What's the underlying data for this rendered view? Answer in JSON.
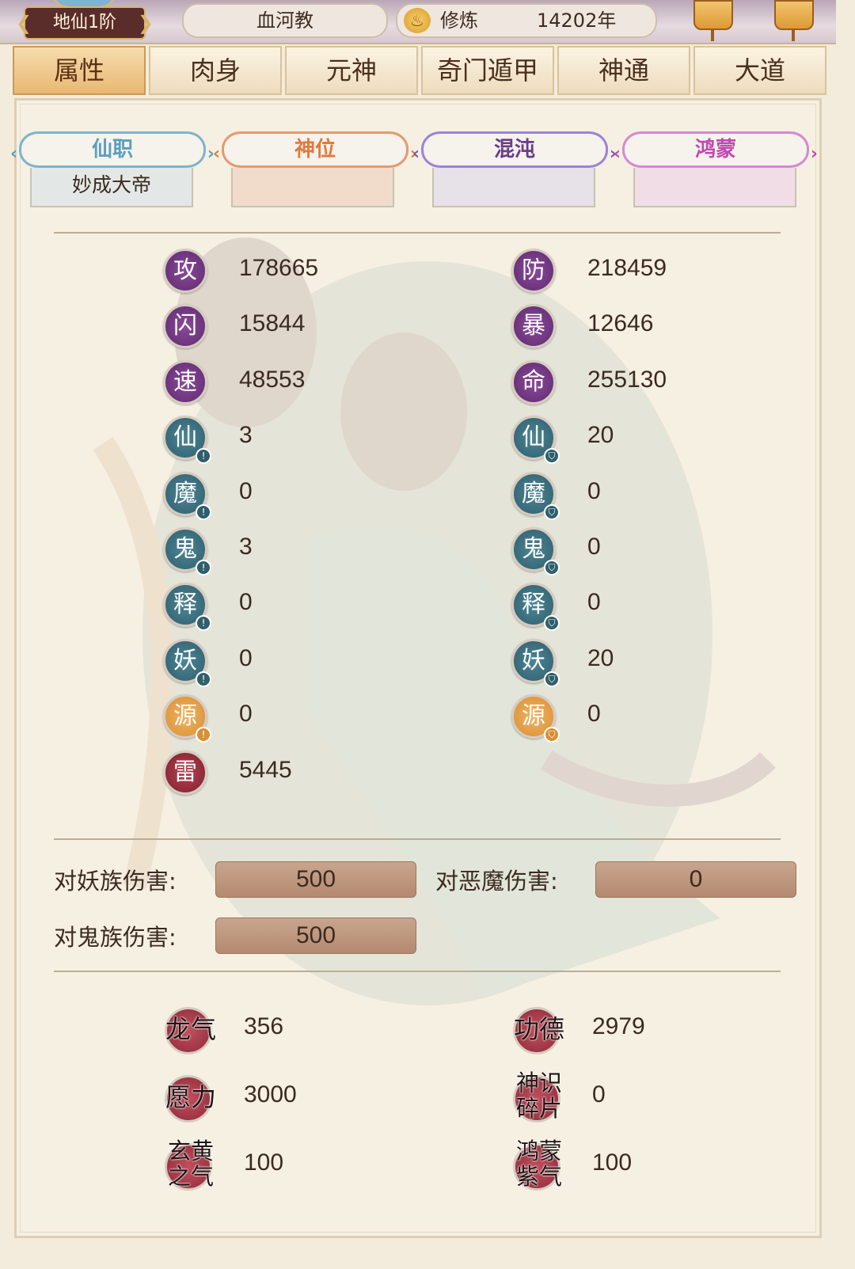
{
  "topbar": {
    "rank": "地仙1阶",
    "sect": "血河教",
    "cultivation_label": "修炼",
    "cultivation_value": "14202年",
    "cultivation_icon": "meditation-icon"
  },
  "tabs": [
    "属性",
    "肉身",
    "元神",
    "奇门遁甲",
    "神通",
    "大道"
  ],
  "active_tab": "属性",
  "titles": [
    {
      "label": "仙职",
      "value": "妙成大帝",
      "color": "#5aa0bd"
    },
    {
      "label": "神位",
      "value": "",
      "color": "#e07a3c"
    },
    {
      "label": "混沌",
      "value": "",
      "color": "#6a3e8a"
    },
    {
      "label": "鸿蒙",
      "value": "",
      "color": "#c04ab0"
    }
  ],
  "stats_left": [
    {
      "char": "攻",
      "value": "178665",
      "kind": "purple"
    },
    {
      "char": "闪",
      "value": "15844",
      "kind": "purple"
    },
    {
      "char": "速",
      "value": "48553",
      "kind": "purple"
    },
    {
      "char": "仙",
      "value": "3",
      "kind": "teal",
      "mark": "!"
    },
    {
      "char": "魔",
      "value": "0",
      "kind": "teal",
      "mark": "!"
    },
    {
      "char": "鬼",
      "value": "3",
      "kind": "teal",
      "mark": "!"
    },
    {
      "char": "释",
      "value": "0",
      "kind": "teal",
      "mark": "!"
    },
    {
      "char": "妖",
      "value": "0",
      "kind": "teal",
      "mark": "!"
    },
    {
      "char": "源",
      "value": "0",
      "kind": "orange",
      "mark": "!"
    },
    {
      "char": "雷",
      "value": "5445",
      "kind": "red"
    }
  ],
  "stats_right": [
    {
      "char": "防",
      "value": "218459",
      "kind": "purple"
    },
    {
      "char": "暴",
      "value": "12646",
      "kind": "purple"
    },
    {
      "char": "命",
      "value": "255130",
      "kind": "purple"
    },
    {
      "char": "仙",
      "value": "20",
      "kind": "teal",
      "mark": "⛉"
    },
    {
      "char": "魔",
      "value": "0",
      "kind": "teal",
      "mark": "⛉"
    },
    {
      "char": "鬼",
      "value": "0",
      "kind": "teal",
      "mark": "⛉"
    },
    {
      "char": "释",
      "value": "0",
      "kind": "teal",
      "mark": "⛉"
    },
    {
      "char": "妖",
      "value": "20",
      "kind": "teal",
      "mark": "⛉"
    },
    {
      "char": "源",
      "value": "0",
      "kind": "orange",
      "mark": "⛉"
    }
  ],
  "damage": {
    "yao": {
      "label": "对妖族伤害:",
      "value": "500"
    },
    "demon": {
      "label": "对恶魔伤害:",
      "value": "0"
    },
    "ghost": {
      "label": "对鬼族伤害:",
      "value": "500"
    }
  },
  "resources_left": [
    {
      "lines": [
        "龙气"
      ],
      "value": "356"
    },
    {
      "lines": [
        "愿力"
      ],
      "value": "3000"
    },
    {
      "lines": [
        "玄黄",
        "之气"
      ],
      "value": "100"
    }
  ],
  "resources_right": [
    {
      "lines": [
        "功德"
      ],
      "value": "2979"
    },
    {
      "lines": [
        "神识",
        "碎片"
      ],
      "value": "0"
    },
    {
      "lines": [
        "鸿蒙",
        "紫气"
      ],
      "value": "100"
    }
  ]
}
